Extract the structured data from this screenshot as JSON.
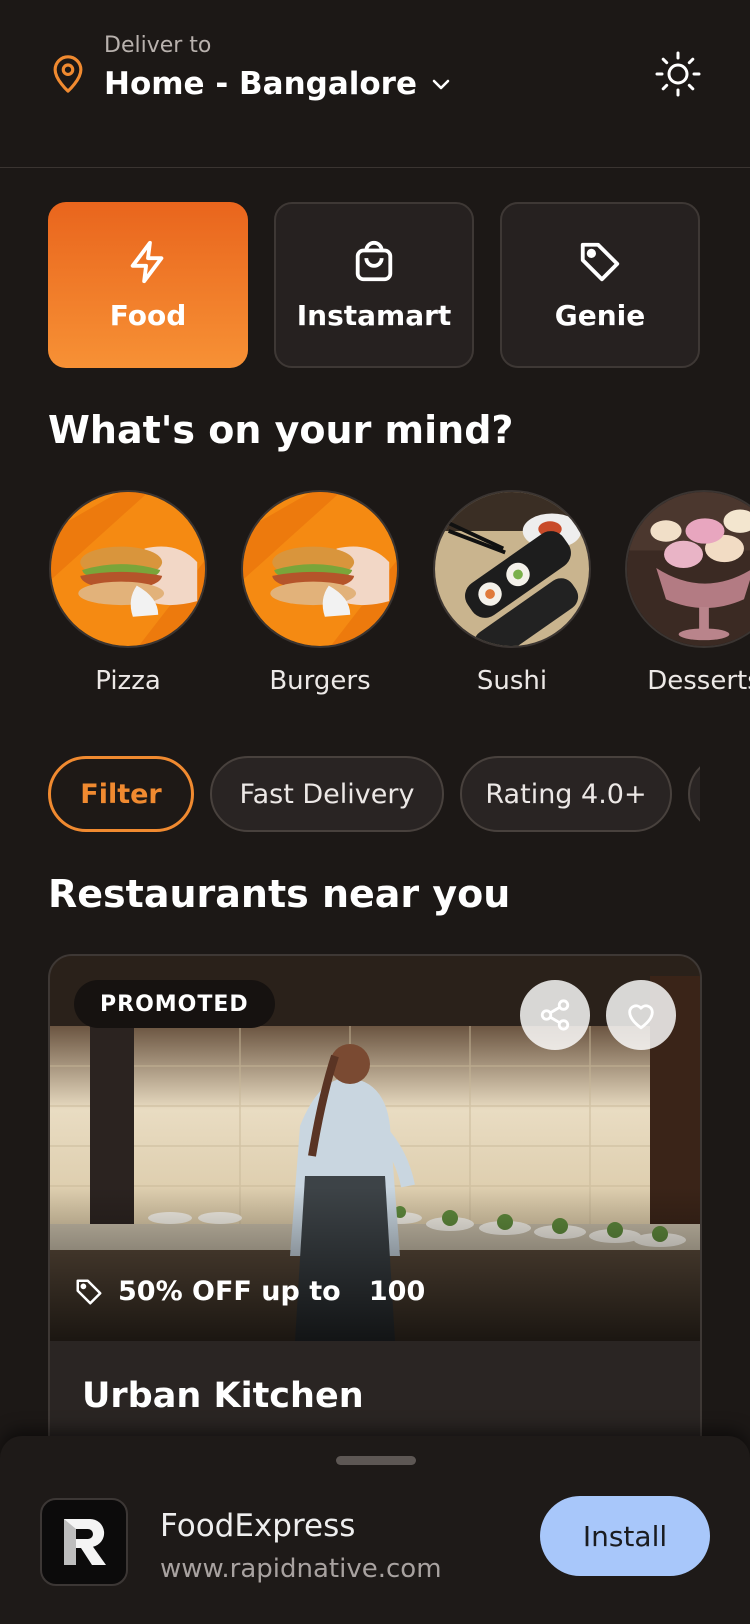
{
  "header": {
    "deliver_label": "Deliver to",
    "location": "Home - Bangalore",
    "icons": [
      "map-pin-icon",
      "chevron-down-icon",
      "sun-icon"
    ]
  },
  "segments": [
    {
      "label": "Food",
      "icon": "lightning-icon",
      "active": true
    },
    {
      "label": "Instamart",
      "icon": "shopping-bag-icon",
      "active": false
    },
    {
      "label": "Genie",
      "icon": "tag-icon",
      "active": false
    }
  ],
  "mind_section": {
    "title": "What's on your mind?",
    "categories": [
      {
        "label": "Pizza"
      },
      {
        "label": "Burgers"
      },
      {
        "label": "Sushi"
      },
      {
        "label": "Desserts"
      }
    ]
  },
  "filters": [
    {
      "label": "Filter",
      "active": true
    },
    {
      "label": "Fast Delivery",
      "active": false
    },
    {
      "label": "Rating 4.0+",
      "active": false
    }
  ],
  "restaurants": {
    "title": "Restaurants near you",
    "card": {
      "badge": "PROMOTED",
      "offer": "50% OFF up to   100",
      "name": "Urban Kitchen"
    }
  },
  "install_banner": {
    "app_name": "FoodExpress",
    "url": "www.rapidnative.com",
    "button": "Install"
  },
  "colors": {
    "accent": "#f08a30",
    "background": "#1c1816",
    "install_button": "#a8c7fa"
  }
}
